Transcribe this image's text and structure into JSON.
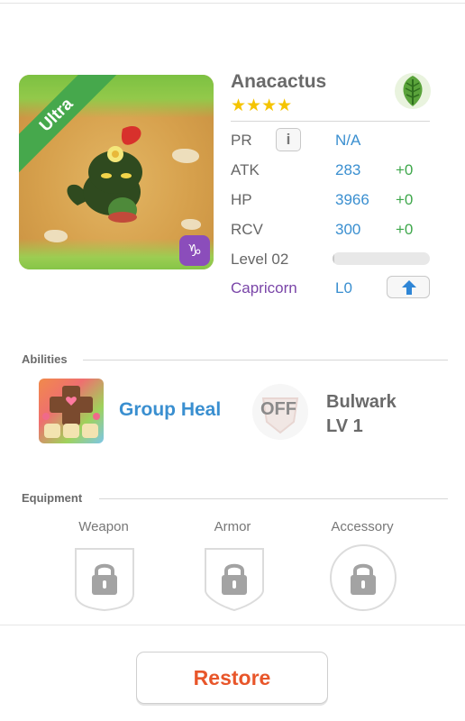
{
  "monster": {
    "name": "Anacactus",
    "stars": "★★★★",
    "rarity": "Ultra",
    "element_icon": "leaf-icon",
    "element_color": "#5aa33b"
  },
  "stats": {
    "pr": {
      "label": "PR",
      "value": "N/A"
    },
    "atk": {
      "label": "ATK",
      "value": "283",
      "bonus": "+0"
    },
    "hp": {
      "label": "HP",
      "value": "3966",
      "bonus": "+0"
    },
    "rcv": {
      "label": "RCV",
      "value": "300",
      "bonus": "+0"
    },
    "level": {
      "label": "Level 02",
      "progress": 0.02
    },
    "sign": {
      "label": "Capricorn",
      "level": "L0",
      "glyph": "♑"
    }
  },
  "abilities": {
    "title": "Abilities",
    "first": {
      "name": "Group Heal"
    },
    "second": {
      "state": "OFF",
      "name": "Bulwark",
      "level": "LV 1"
    }
  },
  "equipment": {
    "title": "Equipment",
    "slots": [
      {
        "label": "Weapon",
        "icon": "lock-icon"
      },
      {
        "label": "Armor",
        "icon": "lock-icon"
      },
      {
        "label": "Accessory",
        "icon": "lock-icon"
      }
    ]
  },
  "actions": {
    "restore_label": "Restore"
  },
  "colors": {
    "accent_blue": "#3a8fd0",
    "bonus_green": "#3fa84c",
    "restore_orange": "#e8562a",
    "sign_purple": "#7a45a8"
  }
}
